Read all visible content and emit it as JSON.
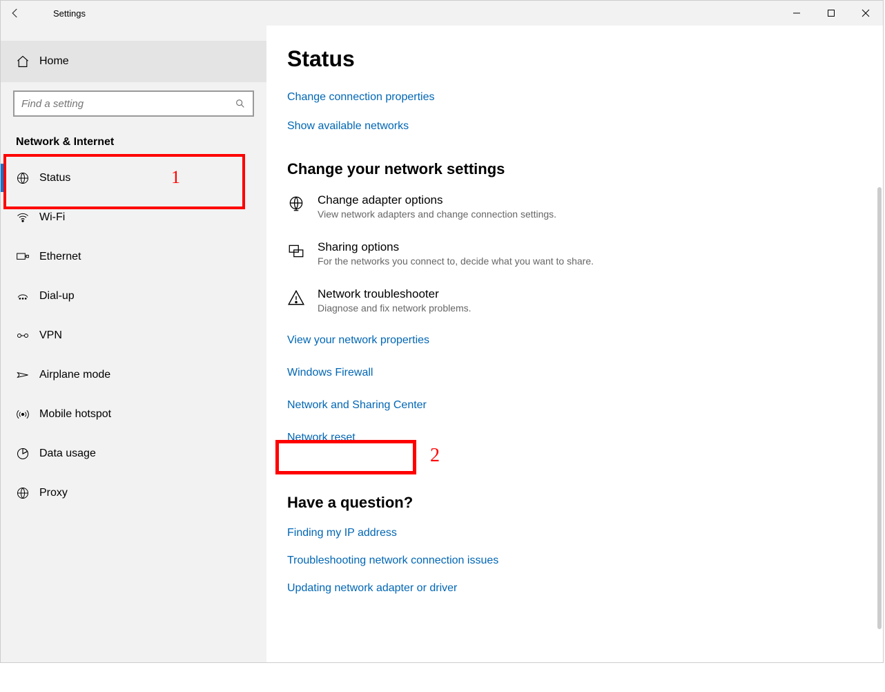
{
  "titlebar": {
    "title": "Settings"
  },
  "sidebar": {
    "home": "Home",
    "search_placeholder": "Find a setting",
    "section": "Network & Internet",
    "items": [
      {
        "label": "Status"
      },
      {
        "label": "Wi-Fi"
      },
      {
        "label": "Ethernet"
      },
      {
        "label": "Dial-up"
      },
      {
        "label": "VPN"
      },
      {
        "label": "Airplane mode"
      },
      {
        "label": "Mobile hotspot"
      },
      {
        "label": "Data usage"
      },
      {
        "label": "Proxy"
      }
    ]
  },
  "page": {
    "heading": "Status",
    "top_links": [
      "Change connection properties",
      "Show available networks"
    ],
    "change_heading": "Change your network settings",
    "settings": [
      {
        "title": "Change adapter options",
        "desc": "View network adapters and change connection settings."
      },
      {
        "title": "Sharing options",
        "desc": "For the networks you connect to, decide what you want to share."
      },
      {
        "title": "Network troubleshooter",
        "desc": "Diagnose and fix network problems."
      }
    ],
    "more_links": [
      "View your network properties",
      "Windows Firewall",
      "Network and Sharing Center",
      "Network reset"
    ],
    "question_heading": "Have a question?",
    "question_links": [
      "Finding my IP address",
      "Troubleshooting network connection issues",
      "Updating network adapter or driver"
    ]
  },
  "annotations": {
    "one": "1",
    "two": "2"
  }
}
